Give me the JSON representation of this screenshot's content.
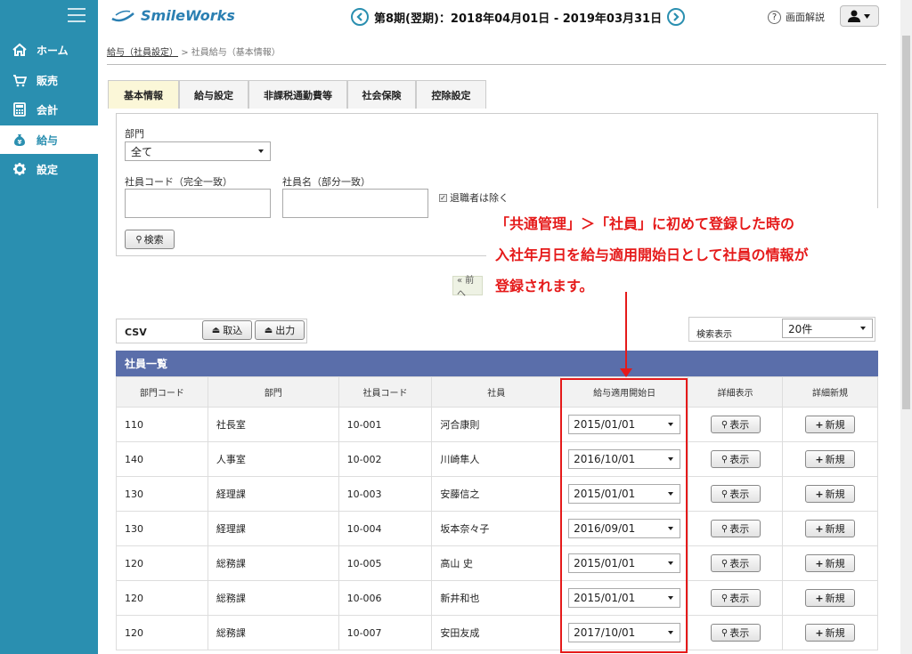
{
  "app": {
    "logo_text": "SmileWorks"
  },
  "header": {
    "period": "第8期(翌期)：2018年04月01日 - 2019年03月31日",
    "help_label": "画面解説"
  },
  "sidebar": {
    "items": [
      {
        "label": "ホーム",
        "icon": "home-icon"
      },
      {
        "label": "販売",
        "icon": "cart-icon"
      },
      {
        "label": "会計",
        "icon": "calculator-icon"
      },
      {
        "label": "給与",
        "icon": "moneybag-icon"
      },
      {
        "label": "設定",
        "icon": "gear-icon"
      }
    ],
    "active": "給与"
  },
  "breadcrumb": {
    "link": "給与（社員設定）",
    "separator": ">",
    "current": "社員給与（基本情報）"
  },
  "tabs": [
    {
      "label": "基本情報",
      "active": true
    },
    {
      "label": "給与設定"
    },
    {
      "label": "非課税通勤費等"
    },
    {
      "label": "社会保険"
    },
    {
      "label": "控除設定"
    }
  ],
  "search": {
    "dept_label": "部門",
    "dept_value": "全て",
    "code_label": "社員コード（完全一致）",
    "name_label": "社員名（部分一致）",
    "exclude_retired_label": "退職者は除く",
    "search_button": "検索",
    "prev_button": "« 前へ"
  },
  "csv": {
    "label": "CSV",
    "import_button": "取込",
    "export_button": "出力"
  },
  "display": {
    "label": "検索表示",
    "value": "20件"
  },
  "table": {
    "title": "社員一覧",
    "columns": [
      "部門コード",
      "部門",
      "社員コード",
      "社員",
      "給与適用開始日",
      "詳細表示",
      "詳細新規"
    ],
    "show_button": "表示",
    "new_button": "新規",
    "rows": [
      {
        "dept_code": "110",
        "dept": "社長室",
        "emp_code": "10-001",
        "emp": "河合康則",
        "start": "2015/01/01"
      },
      {
        "dept_code": "140",
        "dept": "人事室",
        "emp_code": "10-002",
        "emp": "川崎隼人",
        "start": "2016/10/01"
      },
      {
        "dept_code": "130",
        "dept": "経理課",
        "emp_code": "10-003",
        "emp": "安藤信之",
        "start": "2015/01/01"
      },
      {
        "dept_code": "130",
        "dept": "経理課",
        "emp_code": "10-004",
        "emp": "坂本奈々子",
        "start": "2016/09/01"
      },
      {
        "dept_code": "120",
        "dept": "総務課",
        "emp_code": "10-005",
        "emp": "高山 史",
        "start": "2015/01/01"
      },
      {
        "dept_code": "120",
        "dept": "総務課",
        "emp_code": "10-006",
        "emp": "新井和也",
        "start": "2015/01/01"
      },
      {
        "dept_code": "120",
        "dept": "総務課",
        "emp_code": "10-007",
        "emp": "安田友成",
        "start": "2017/10/01"
      }
    ]
  },
  "annotation": {
    "line1": "「共通管理」＞「社員」に初めて登録した時の",
    "line2": "入社年月日を給与適用開始日として社員の情報が",
    "line3": "登録されます。",
    "color": "#e51a1a"
  }
}
